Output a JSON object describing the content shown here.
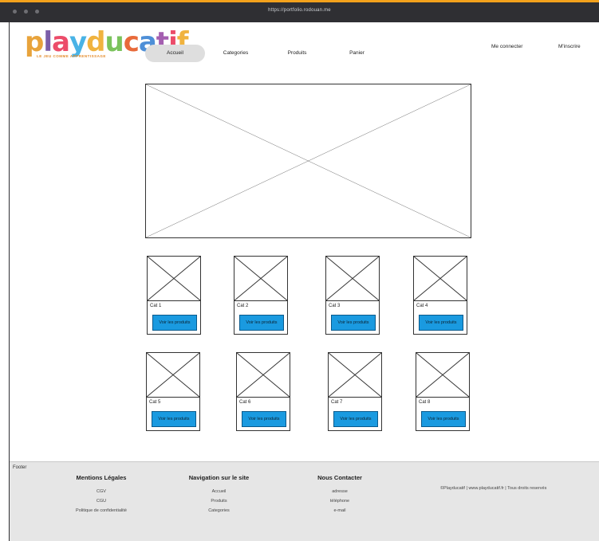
{
  "browser": {
    "url": "https://portfolio.rodouan.me"
  },
  "logo": {
    "letters": [
      {
        "ch": "p",
        "color": "#e8a33b"
      },
      {
        "ch": "l",
        "color": "#7b5ea8"
      },
      {
        "ch": "a",
        "color": "#ec4c6a"
      },
      {
        "ch": "y",
        "color": "#49b3e6"
      },
      {
        "ch": "d",
        "color": "#f0b33f"
      },
      {
        "ch": "u",
        "color": "#7bc35c"
      },
      {
        "ch": "c",
        "color": "#e86a3a"
      },
      {
        "ch": "a",
        "color": "#4e8fd7"
      },
      {
        "ch": "t",
        "color": "#a45fb0"
      },
      {
        "ch": "i",
        "color": "#ec4c6a"
      },
      {
        "ch": "f",
        "color": "#f0b33f"
      }
    ],
    "tagline": "LE JEU COMME APPRENTISSAGE"
  },
  "nav": {
    "items": [
      "Accueil",
      "Categories",
      "Produits",
      "Panier"
    ],
    "active": "Accueil",
    "login": "Me connecter",
    "signup": "M'inscrire"
  },
  "categories": [
    {
      "label": "Cat 1",
      "button": "Voir les produits"
    },
    {
      "label": "Cat 2",
      "button": "Voir les produits"
    },
    {
      "label": "Cat 3",
      "button": "Voir les produits"
    },
    {
      "label": "Cat 4",
      "button": "Voir les produits"
    },
    {
      "label": "Cat 5",
      "button": "Voir les produits"
    },
    {
      "label": "Cat 6",
      "button": "Voir les produits"
    },
    {
      "label": "Cat 7",
      "button": "Voir les produits"
    },
    {
      "label": "Cat 8",
      "button": "Voir les produits"
    }
  ],
  "footer": {
    "tag": "Footer",
    "legal": {
      "title": "Mentions Légales",
      "links": [
        "CGV",
        "CGU",
        "Politique de confidentialité"
      ]
    },
    "navigation": {
      "title": "Navigation sur le site",
      "links": [
        "Accueil",
        "Produits",
        "Categories"
      ]
    },
    "contact": {
      "title": "Nous Contacter",
      "links": [
        "adresse",
        "téléphone",
        "e-mail"
      ]
    },
    "copyright": "©Playducatif | www.playducatif.fr | Tous droits reservés"
  },
  "colors": {
    "accent": "#f3a11c",
    "button": "#1a9ae0",
    "nav_active": "#dedede"
  }
}
